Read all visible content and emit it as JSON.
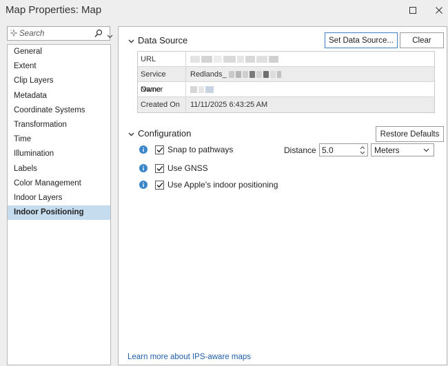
{
  "window": {
    "title": "Map Properties: Map"
  },
  "search": {
    "placeholder": "Search"
  },
  "nav": {
    "items": [
      {
        "label": "General",
        "selected": false
      },
      {
        "label": "Extent",
        "selected": false
      },
      {
        "label": "Clip Layers",
        "selected": false
      },
      {
        "label": "Metadata",
        "selected": false
      },
      {
        "label": "Coordinate Systems",
        "selected": false
      },
      {
        "label": "Transformation",
        "selected": false
      },
      {
        "label": "Time",
        "selected": false
      },
      {
        "label": "Illumination",
        "selected": false
      },
      {
        "label": "Labels",
        "selected": false
      },
      {
        "label": "Color Management",
        "selected": false
      },
      {
        "label": "Indoor Layers",
        "selected": false
      },
      {
        "label": "Indoor Positioning",
        "selected": true
      }
    ]
  },
  "data_source": {
    "heading": "Data Source",
    "set_button": "Set Data Source...",
    "clear_button": "Clear",
    "rows": [
      {
        "label": "URL",
        "value": ""
      },
      {
        "label": "Service Name",
        "value": "Redlands_"
      },
      {
        "label": "Owner",
        "value": ""
      },
      {
        "label": "Created On",
        "value": "11/11/2025 6:43:25 AM"
      }
    ]
  },
  "configuration": {
    "heading": "Configuration",
    "restore_button": "Restore Defaults",
    "options": [
      {
        "label": "Snap to pathways",
        "checked": true
      },
      {
        "label": "Use GNSS",
        "checked": true
      },
      {
        "label": "Use Apple's indoor positioning",
        "checked": true
      }
    ],
    "distance_label": "Distance",
    "distance_value": "5.0",
    "distance_unit": "Meters"
  },
  "footer": {
    "learn_link": "Learn more about IPS-aware maps"
  },
  "colors": {
    "selected_nav": "#c5dcee",
    "info_blue": "#3a86c8",
    "link_blue": "#1f5ea8",
    "primary_border": "#3f7fbf"
  }
}
